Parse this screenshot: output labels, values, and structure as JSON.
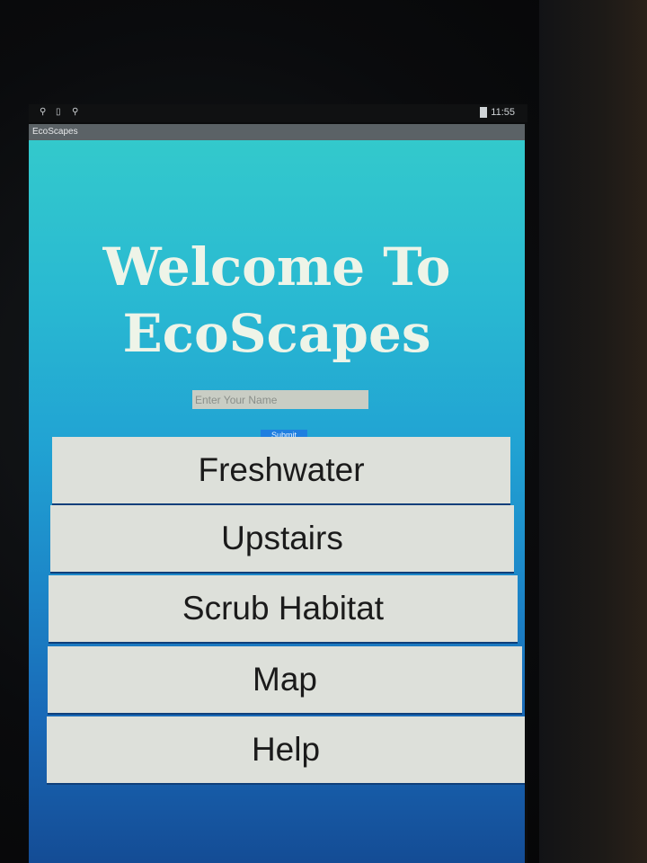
{
  "status_bar": {
    "time": "11:55",
    "notification_icons": [
      "location-pin-icon",
      "phone-icon",
      "location-pin-icon"
    ],
    "battery_icon": "battery-icon"
  },
  "app": {
    "title": "EcoScapes"
  },
  "main": {
    "welcome_text": "Welcome  To\nEcoScapes",
    "name_input": {
      "value": "",
      "placeholder": "Enter Your Name"
    },
    "submit_label": "Submit",
    "menu": [
      {
        "label": "Freshwater"
      },
      {
        "label": "Upstairs"
      },
      {
        "label": "Scrub Habitat"
      },
      {
        "label": "Map"
      },
      {
        "label": "Help"
      }
    ]
  },
  "colors": {
    "gradient_top": "#33c9cc",
    "gradient_bottom": "#144c95",
    "button_bg": "#dde0da",
    "submit_bg": "#1f7fe0",
    "title_bar_bg": "#5b6266"
  }
}
